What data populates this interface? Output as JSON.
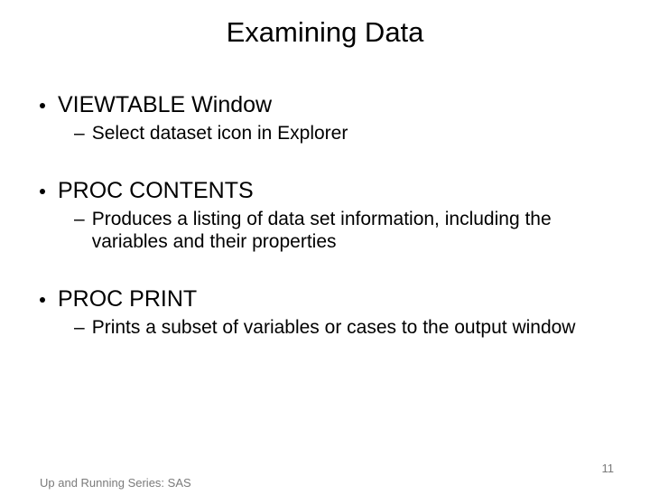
{
  "title": "Examining Data",
  "groups": [
    {
      "heading": "VIEWTABLE Window",
      "sub": "Select dataset icon in Explorer"
    },
    {
      "heading": "PROC CONTENTS",
      "sub": "Produces a listing of data set information, including the variables and their properties"
    },
    {
      "heading": "PROC PRINT",
      "sub": "Prints a subset of variables or cases to the output window"
    }
  ],
  "footer": "Up and Running Series: SAS",
  "page_number": "11"
}
